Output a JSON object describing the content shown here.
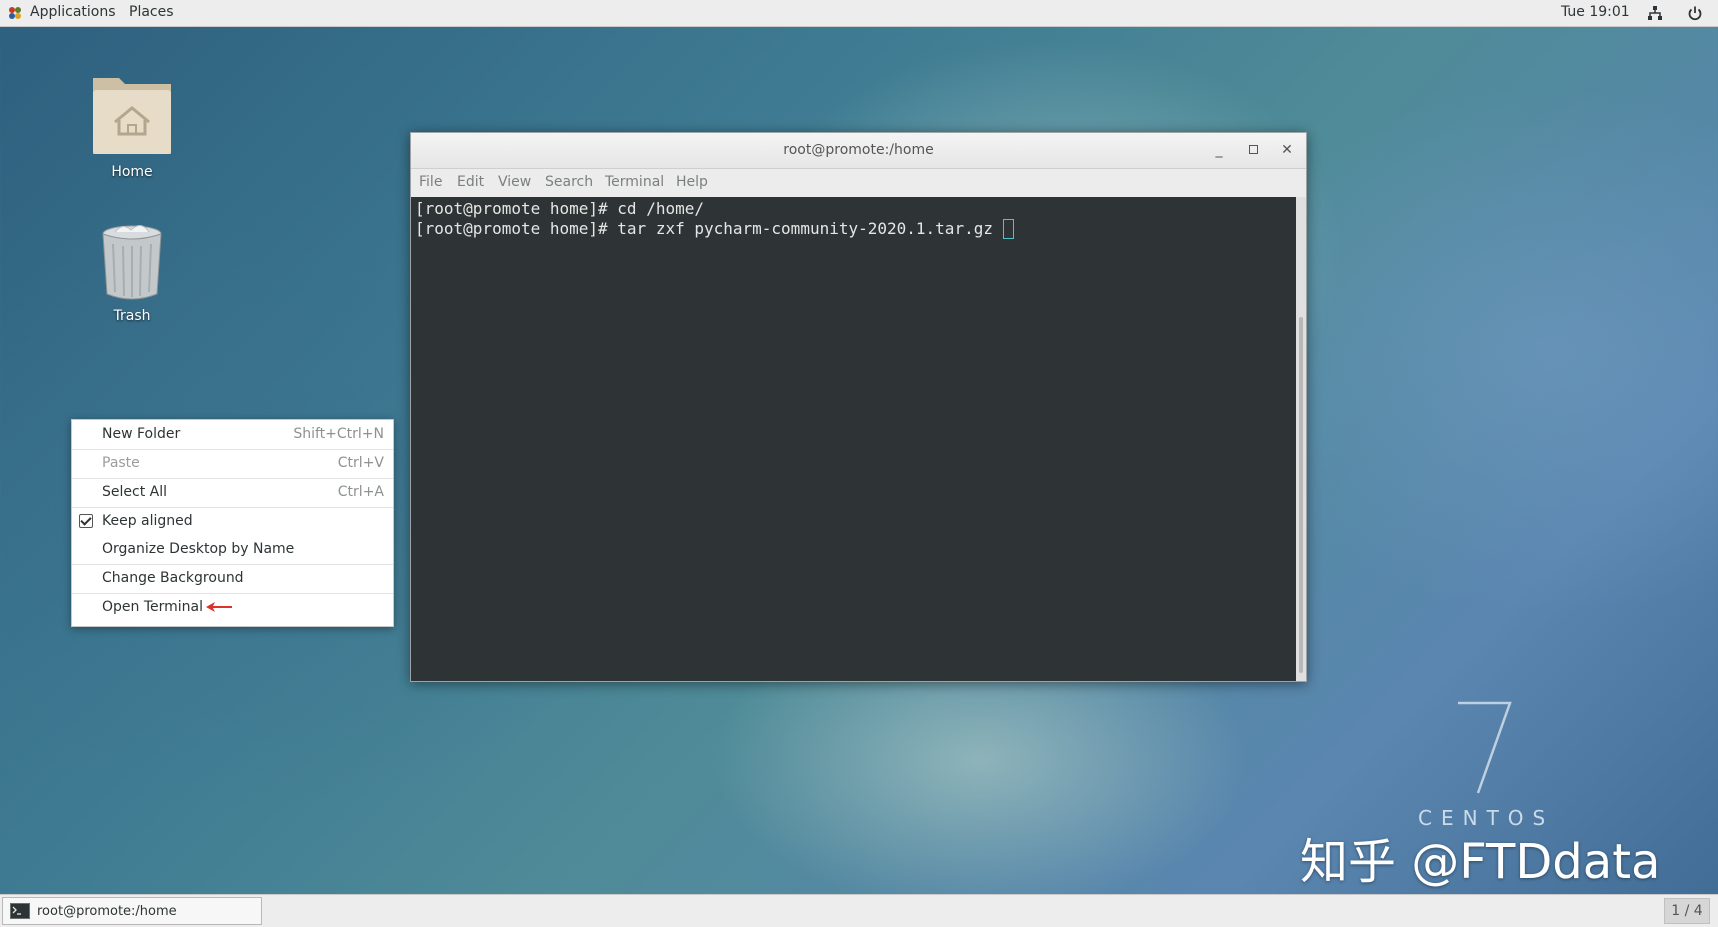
{
  "top_panel": {
    "applications": "Applications",
    "places": "Places",
    "clock": "Tue 19:01"
  },
  "desktop": {
    "icons": [
      {
        "label": "Home"
      },
      {
        "label": "Trash"
      }
    ]
  },
  "terminal": {
    "title": "root@promote:/home",
    "menu": [
      "File",
      "Edit",
      "View",
      "Search",
      "Terminal",
      "Help"
    ],
    "lines": [
      "[root@promote home]# cd /home/",
      "[root@promote home]# tar zxf pycharm-community-2020.1.tar.gz"
    ]
  },
  "context_menu": {
    "items": [
      {
        "label": "New Folder",
        "accel": "Shift+Ctrl+N",
        "disabled": false
      },
      {
        "label": "Paste",
        "accel": "Ctrl+V",
        "disabled": true
      },
      {
        "label": "Select All",
        "accel": "Ctrl+A",
        "disabled": false
      },
      {
        "label": "Keep aligned",
        "checked": true
      },
      {
        "label": "Organize Desktop by Name"
      },
      {
        "label": "Change Background"
      },
      {
        "label": "Open Terminal"
      }
    ]
  },
  "taskbar": {
    "window_label": "root@promote:/home",
    "workspace": "1 / 4"
  },
  "branding": {
    "centos_text": "CENTOS",
    "centos_version": "7",
    "watermark": "知乎 @FTDdata"
  },
  "colors": {
    "arrow": "#e0302a",
    "cursor": "#4ec4c8",
    "terminal_bg": "#2e3436"
  }
}
